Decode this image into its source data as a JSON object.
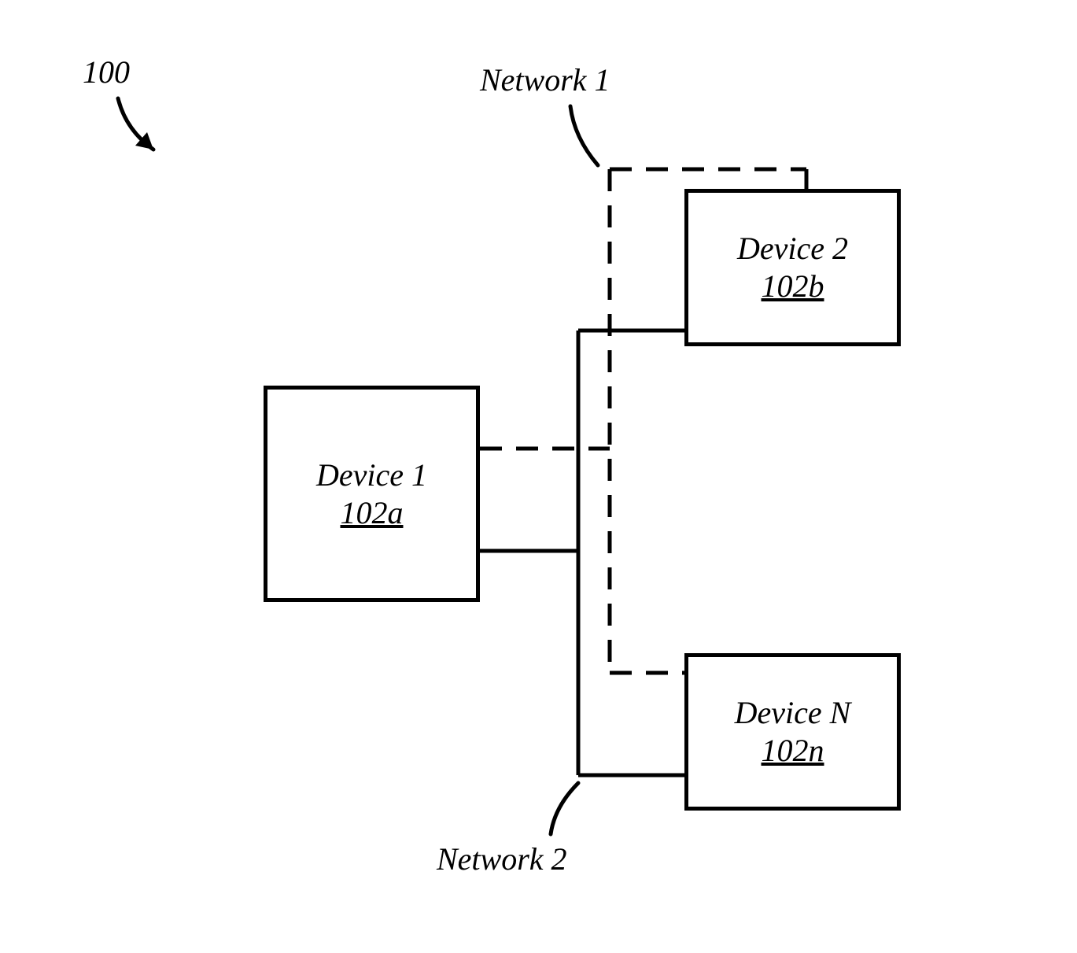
{
  "figure_ref": "100",
  "network_labels": {
    "net1": "Network 1",
    "net2": "Network 2"
  },
  "devices": {
    "d1": {
      "title": "Device 1",
      "ref": "102a"
    },
    "d2": {
      "title": "Device 2",
      "ref": "102b"
    },
    "dn": {
      "title": "Device N",
      "ref": "102n"
    }
  }
}
